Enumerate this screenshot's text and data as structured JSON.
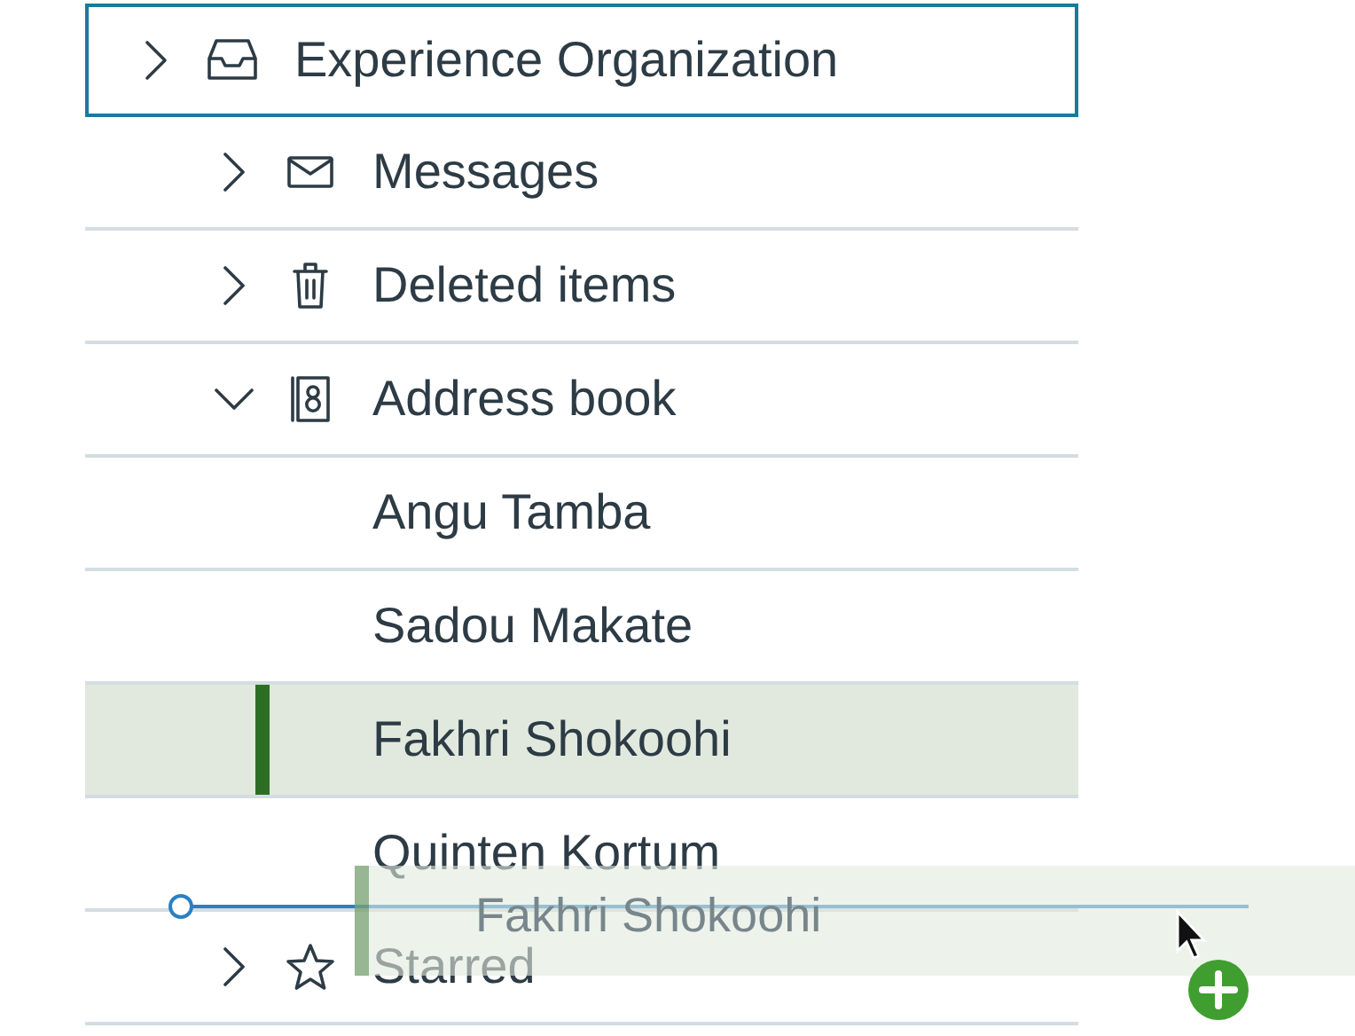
{
  "tree": {
    "label": "Experience Organization",
    "kind": "inbox",
    "expanded": false,
    "focused": true,
    "selected": false,
    "children": [
      {
        "label": "Messages",
        "kind": "mail",
        "expanded": false,
        "selected": false
      },
      {
        "label": "Deleted items",
        "kind": "trash",
        "expanded": false,
        "selected": false
      },
      {
        "label": "Address book",
        "kind": "contacts",
        "expanded": true,
        "selected": false,
        "children": [
          {
            "label": "Angu Tamba",
            "selected": false
          },
          {
            "label": "Sadou Makate",
            "selected": false
          },
          {
            "label": "Fakhri Shokoohi",
            "selected": true
          },
          {
            "label": "Quinten Kortum",
            "selected": false
          }
        ]
      },
      {
        "label": "Starred",
        "kind": "star",
        "expanded": false,
        "selected": false
      }
    ]
  },
  "drag_ghost": {
    "label": "Fakhri Shokoohi"
  }
}
